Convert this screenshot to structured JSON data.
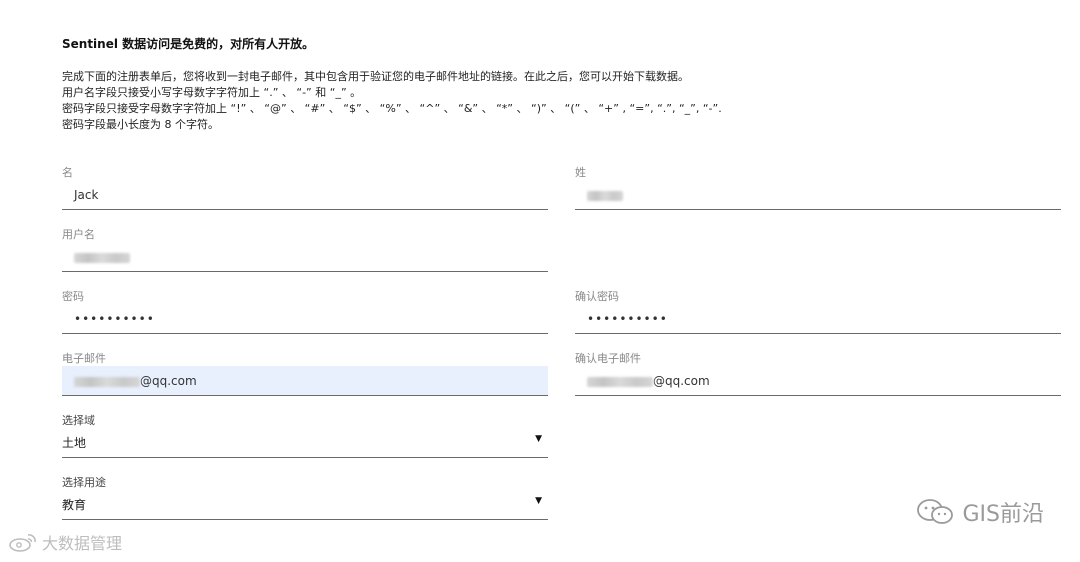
{
  "intro": {
    "heading": "Sentinel 数据访问是免费的，对所有人开放。",
    "lines": [
      "完成下面的注册表单后，您将收到一封电子邮件，其中包含用于验证您的电子邮件地址的链接。在此之后，您可以开始下载数据。",
      "用户名字段只接受小写字母数字字符加上 “.” 、 “-” 和 “_” 。",
      "密码字段只接受字母数字字符加上 “!” 、 “@” 、 “#” 、 “$” 、 “%” 、 “^” 、 “&” 、 “*” 、 “)” 、 “(” 、 “+” , “=”, “.”, “_”, “-”.",
      "密码字段最小长度为 8 个字符。"
    ]
  },
  "form": {
    "first_name": {
      "label": "名",
      "value": "Jack"
    },
    "last_name": {
      "label": "姓"
    },
    "username": {
      "label": "用户名"
    },
    "password": {
      "label": "密码",
      "value": "••••••••••"
    },
    "confirm_password": {
      "label": "确认密码",
      "value": "••••••••••"
    },
    "email": {
      "label": "电子邮件",
      "suffix": "@qq.com"
    },
    "confirm_email": {
      "label": "确认电子邮件",
      "suffix": "@qq.com"
    },
    "domain": {
      "label": "选择域",
      "value": "土地"
    },
    "usage": {
      "label": "选择用途",
      "value": "教育"
    }
  },
  "watermarks": {
    "right": "GIS前沿",
    "left": "大数据管理"
  },
  "icons": {
    "dropdown": "▼"
  }
}
